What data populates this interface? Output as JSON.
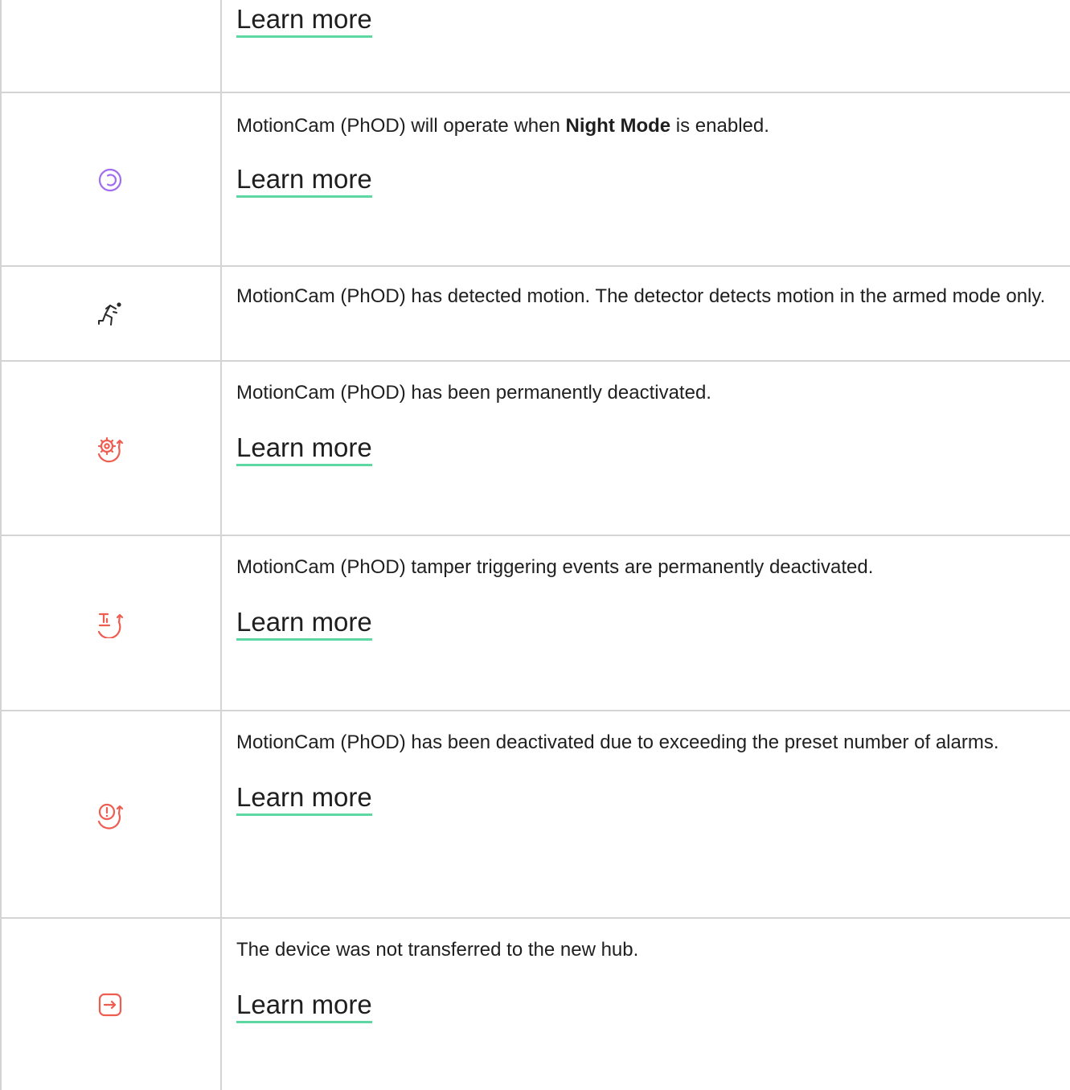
{
  "link_label": "Learn more",
  "colors": {
    "purple": "#a06df0",
    "red": "#ee5d4f",
    "dark": "#2a2a2a",
    "link_underline": "#5fd7a3",
    "rule": "#d4d4d4"
  },
  "rows": [
    {
      "icon": "",
      "text": "",
      "has_link": true
    },
    {
      "icon": "night-mode-icon",
      "text_before": "MotionCam (PhOD) will operate when ",
      "text_bold": "Night Mode",
      "text_after": " is enabled.",
      "has_link": true
    },
    {
      "icon": "running-person-icon",
      "text": "MotionCam (PhOD) has detected motion. The detector detects motion in the armed mode only.",
      "has_link": false
    },
    {
      "icon": "gear-deactivated-icon",
      "text": "MotionCam (PhOD) has been permanently deactivated.",
      "has_link": true
    },
    {
      "icon": "tamper-deactivated-icon",
      "text": "MotionCam (PhOD) tamper triggering events are permanently deactivated.",
      "has_link": true
    },
    {
      "icon": "alarm-limit-deactivated-icon",
      "text": "MotionCam (PhOD) has been deactivated due to exceeding the preset number of alarms.",
      "has_link": true
    },
    {
      "icon": "transfer-icon",
      "text": "The device was not transferred to the new hub.",
      "has_link": true
    }
  ]
}
